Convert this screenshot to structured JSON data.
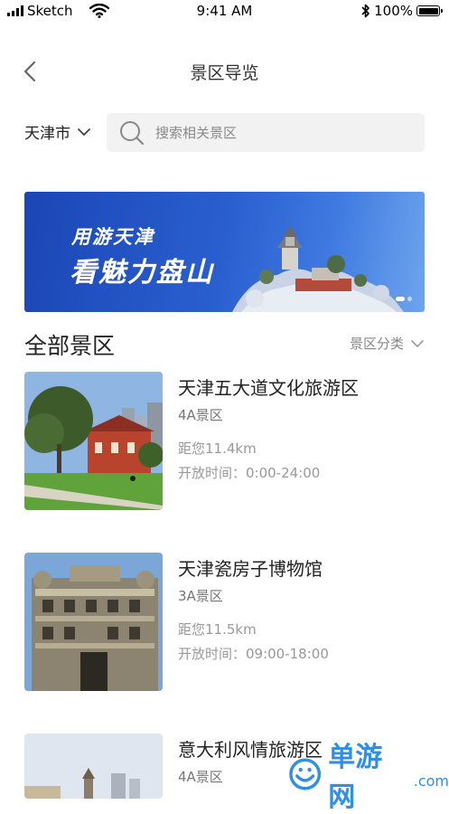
{
  "status_bar": {
    "carrier": "Sketch",
    "time": "9:41 AM",
    "battery": "100%",
    "icons": [
      "signal-icon",
      "wifi-icon",
      "bluetooth-icon",
      "battery-icon"
    ]
  },
  "nav": {
    "title": "景区导览",
    "back_icon": "chevron-left-icon"
  },
  "location": {
    "city": "天津市",
    "icon": "chevron-down-icon"
  },
  "search": {
    "placeholder": "搜索相关景区",
    "value": "",
    "icon": "search-icon"
  },
  "banner": {
    "line1": "用游天津",
    "line2": "看魅力盘山",
    "pager": {
      "count": 2,
      "active": 0
    }
  },
  "section": {
    "title": "全部景区",
    "filter_label": "景区分类"
  },
  "scenic_spots": [
    {
      "name": "天津五大道文化旅游区",
      "level": "4A景区",
      "distance": "距您11.4km",
      "hours": "开放时间：0:00-24:00"
    },
    {
      "name": "天津瓷房子博物馆",
      "level": "3A景区",
      "distance": "距您11.5km",
      "hours": "开放时间：09:00-18:00"
    },
    {
      "name": "意大利风情旅游区",
      "level": "4A景区"
    }
  ],
  "watermark": {
    "text": "单游网",
    "suffix": ".com"
  },
  "colors": {
    "banner_blue": "#1b46b5",
    "watermark_blue": "#2f8ee8",
    "search_bg": "#f2f2f2"
  }
}
